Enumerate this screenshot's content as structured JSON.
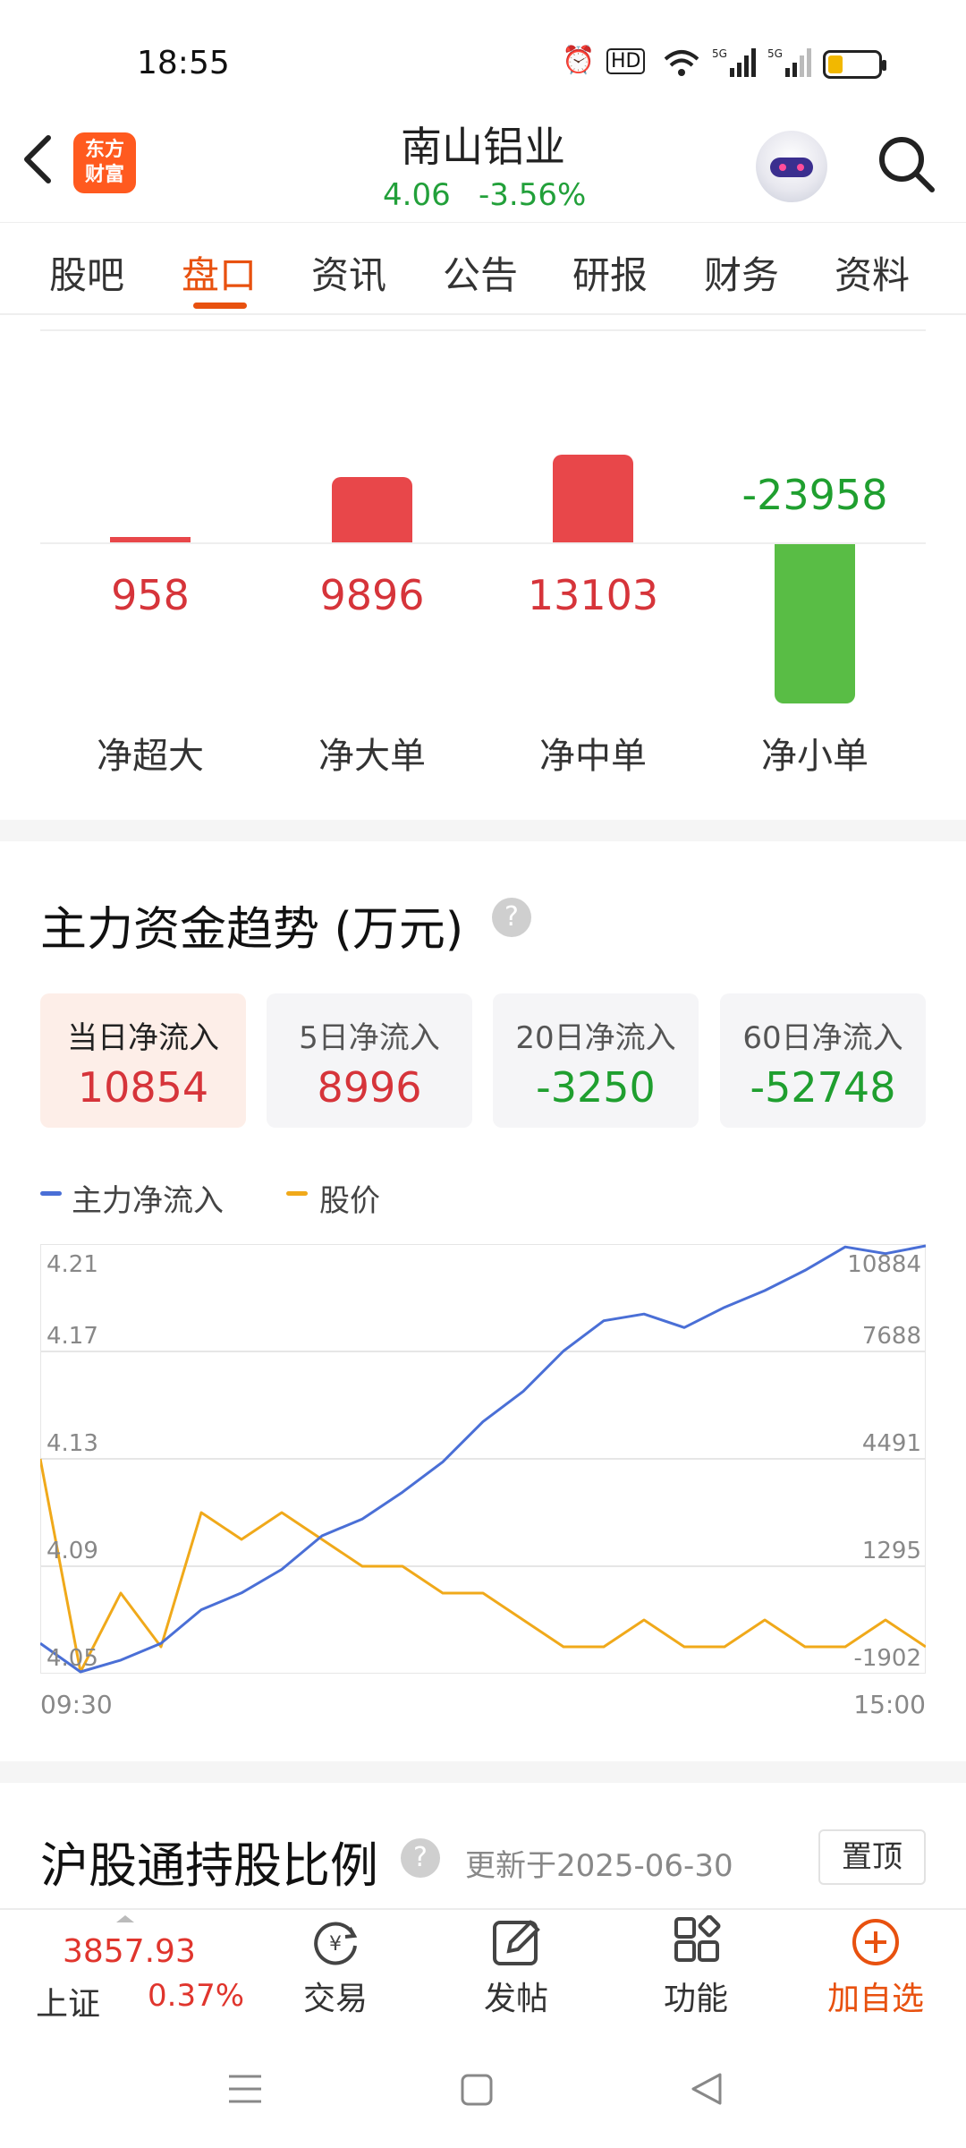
{
  "status_bar": {
    "time": "18:55",
    "network": "5G",
    "hd_badge": "HD"
  },
  "header": {
    "logo_line1": "东方",
    "logo_line2": "财富",
    "stock_name": "南山铝业",
    "price": "4.06",
    "change": "-3.56%"
  },
  "tabs": [
    {
      "label": "股吧"
    },
    {
      "label": "盘口",
      "active": true
    },
    {
      "label": "资讯"
    },
    {
      "label": "公告"
    },
    {
      "label": "研报"
    },
    {
      "label": "财务"
    },
    {
      "label": "资料"
    }
  ],
  "net_flow": {
    "items": [
      {
        "label": "净超大",
        "value": "958",
        "sign": "pos"
      },
      {
        "label": "净大单",
        "value": "9896",
        "sign": "pos"
      },
      {
        "label": "净中单",
        "value": "13103",
        "sign": "pos"
      },
      {
        "label": "净小单",
        "value": "-23958",
        "sign": "neg"
      }
    ]
  },
  "trend": {
    "title": "主力资金趋势 (万元)",
    "help": "?",
    "cards": [
      {
        "label": "当日净流入",
        "value": "10854"
      },
      {
        "label": "5日净流入",
        "value": "8996"
      },
      {
        "label": "20日净流入",
        "value": "-3250"
      },
      {
        "label": "60日净流入",
        "value": "-52748"
      }
    ],
    "legend": {
      "main": "主力净流入",
      "price": "股价"
    },
    "colors": {
      "main": "#4a6fd6",
      "price": "#f0a91a",
      "up": "#e0352d",
      "down": "#1f9f2f"
    },
    "left_ticks": [
      "4.21",
      "4.17",
      "4.13",
      "4.09",
      "4.05"
    ],
    "right_ticks": [
      "10884",
      "7688",
      "4491",
      "1295",
      "-1902"
    ],
    "time_start": "09:30",
    "time_end": "15:00"
  },
  "chart_data": {
    "type": "line",
    "x": [
      "09:30",
      "15:00"
    ],
    "series": [
      {
        "name": "主力净流入",
        "values": [
          -1000,
          -1850,
          -1500,
          -1000,
          0,
          500,
          1200,
          2200,
          2700,
          3500,
          4400,
          5600,
          6500,
          7700,
          8600,
          8800,
          8400,
          9000,
          9500,
          10100,
          10800,
          10600,
          10854
        ]
      },
      {
        "name": "股价",
        "values": [
          4.13,
          4.05,
          4.08,
          4.06,
          4.11,
          4.1,
          4.11,
          4.1,
          4.09,
          4.09,
          4.08,
          4.08,
          4.07,
          4.06,
          4.06,
          4.07,
          4.06,
          4.06,
          4.07,
          4.06,
          4.06,
          4.07,
          4.06
        ]
      }
    ],
    "ylim_left": [
      4.05,
      4.21
    ],
    "ylim_right": [
      -1902,
      10884
    ]
  },
  "holding": {
    "title": "沪股通持股比例",
    "help": "?",
    "update": "更新于2025-06-30",
    "pin": "置顶"
  },
  "toolbar": {
    "index_value": "3857.93",
    "index_name": "上证",
    "index_change": "0.37%",
    "trade": "交易",
    "post": "发帖",
    "func": "功能",
    "add": "加自选"
  }
}
